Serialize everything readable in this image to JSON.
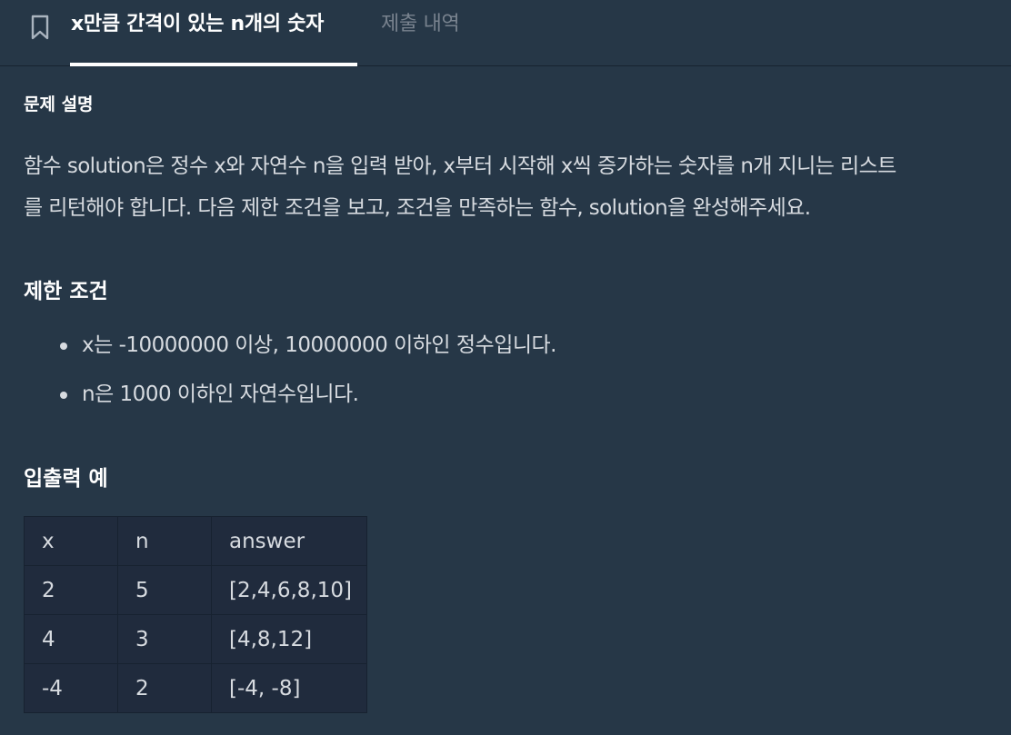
{
  "tabs": {
    "active_title": "x만큼 간격이 있는 n개의 숫자",
    "history_label": "제출 내역"
  },
  "problem": {
    "section_label": "문제 설명",
    "description_lines": [
      "함수 solution은 정수 x와 자연수 n을 입력 받아, x부터 시작해 x씩 증가하는 숫자를 n개 지니는 리스트",
      "를 리턴해야 합니다. 다음 제한 조건을 보고, 조건을 만족하는 함수, solution을 완성해주세요."
    ],
    "constraints_heading": "제한 조건",
    "constraints": [
      "x는 -10000000 이상, 10000000 이하인 정수입니다.",
      "n은 1000 이하인 자연수입니다."
    ],
    "io_heading": "입출력 예",
    "io_table": {
      "headers": [
        "x",
        "n",
        "answer"
      ],
      "rows": [
        [
          "2",
          "5",
          "[2,4,6,8,10]"
        ],
        [
          "4",
          "3",
          "[4,8,12]"
        ],
        [
          "-4",
          "2",
          "[-4, -8]"
        ]
      ]
    }
  },
  "colors": {
    "background": "#263747",
    "table_background": "#202b3d",
    "text": "#d7dbe0",
    "inactive_tab": "#78828e"
  },
  "icons": {
    "bookmark": "bookmark-icon"
  }
}
